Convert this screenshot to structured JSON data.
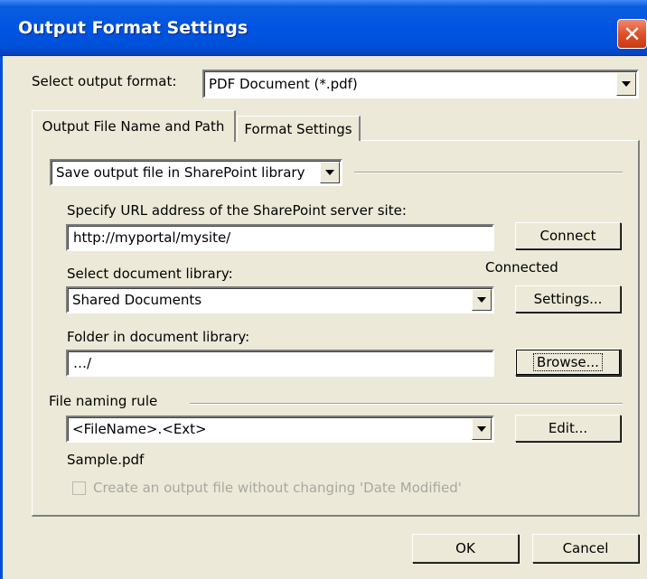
{
  "window": {
    "title": "Output Format Settings",
    "close_glyph": "✕"
  },
  "format": {
    "label": "Select output format:",
    "value": "PDF Document (*.pdf)"
  },
  "tabs": [
    {
      "label": "Output File Name and Path",
      "active": true
    },
    {
      "label": "Format Settings",
      "active": false
    }
  ],
  "save_location": {
    "value": "Save output file in SharePoint library"
  },
  "url": {
    "label": "Specify URL address of the SharePoint server site:",
    "value": "http://myportal/mysite/",
    "connect_label": "Connect",
    "status": "Connected"
  },
  "library": {
    "label": "Select document library:",
    "value": "Shared Documents",
    "settings_label": "Settings..."
  },
  "folder": {
    "label": "Folder in document library:",
    "value": "…/",
    "browse_label": "Browse..."
  },
  "naming": {
    "label": "File naming rule",
    "value": "<FileName>.<Ext>",
    "edit_label": "Edit...",
    "sample": "Sample.pdf"
  },
  "options": {
    "keep_date_label": "Create an output file without changing 'Date Modified'",
    "keep_date_checked": false
  },
  "footer": {
    "ok_label": "OK",
    "cancel_label": "Cancel"
  },
  "icons": {
    "close": "close-icon",
    "dropdown": "chevron-down-icon"
  }
}
